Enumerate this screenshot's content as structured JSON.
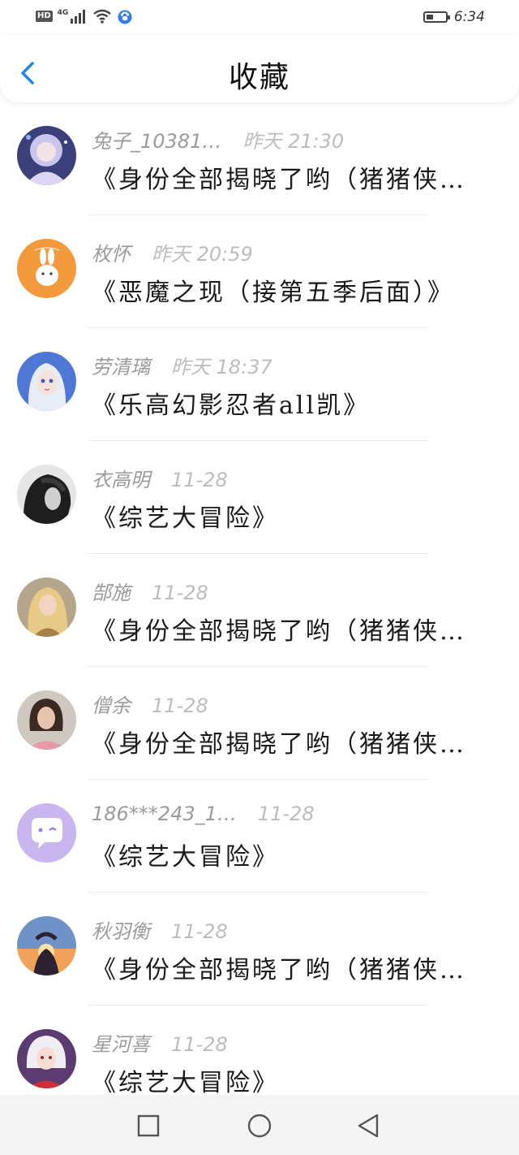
{
  "status_bar": {
    "hd_label": "HD",
    "network_label": "4G",
    "battery_level": 0.35,
    "time": "6:34",
    "icons": [
      "signal-icon",
      "wifi-icon",
      "paw-icon",
      "battery-icon"
    ]
  },
  "header": {
    "title": "收藏",
    "back_icon": "chevron-left-icon",
    "accent_color": "#1e88e5"
  },
  "items": [
    {
      "name": "兔子_10381…",
      "time": "昨天 21:30",
      "title": "《身份全部揭晓了哟（猪猪侠…",
      "avatar": "avatar-anime-girl-purple"
    },
    {
      "name": "枚怀",
      "time": "昨天 20:59",
      "title": "《恶魔之现（接第五季后面）》",
      "avatar": "avatar-orange-rabbit"
    },
    {
      "name": "劳清璃",
      "time": "昨天 18:37",
      "title": "《乐高幻影忍者all凯》",
      "avatar": "avatar-elsa"
    },
    {
      "name": "衣高明",
      "time": "11-28",
      "title": "《综艺大冒险》",
      "avatar": "avatar-dark-boy"
    },
    {
      "name": "郜施",
      "time": "11-28",
      "title": "《身份全部揭晓了哟（猪猪侠…",
      "avatar": "avatar-blonde-girl"
    },
    {
      "name": "僧余",
      "time": "11-28",
      "title": "《身份全部揭晓了哟（猪猪侠…",
      "avatar": "avatar-brunette-girl"
    },
    {
      "name": "186***243_1…",
      "time": "11-28",
      "title": "《综艺大冒险》",
      "avatar": "avatar-chat-bubble"
    },
    {
      "name": "秋羽衡",
      "time": "11-28",
      "title": "《身份全部揭晓了哟（猪猪侠…",
      "avatar": "avatar-sunset-heart"
    },
    {
      "name": "星河喜",
      "time": "11-28",
      "title": "《综艺大冒险》",
      "avatar": "avatar-anime-white-hair"
    }
  ],
  "nav": {
    "buttons": [
      "recent-apps-icon",
      "home-icon",
      "back-triangle-icon"
    ]
  }
}
